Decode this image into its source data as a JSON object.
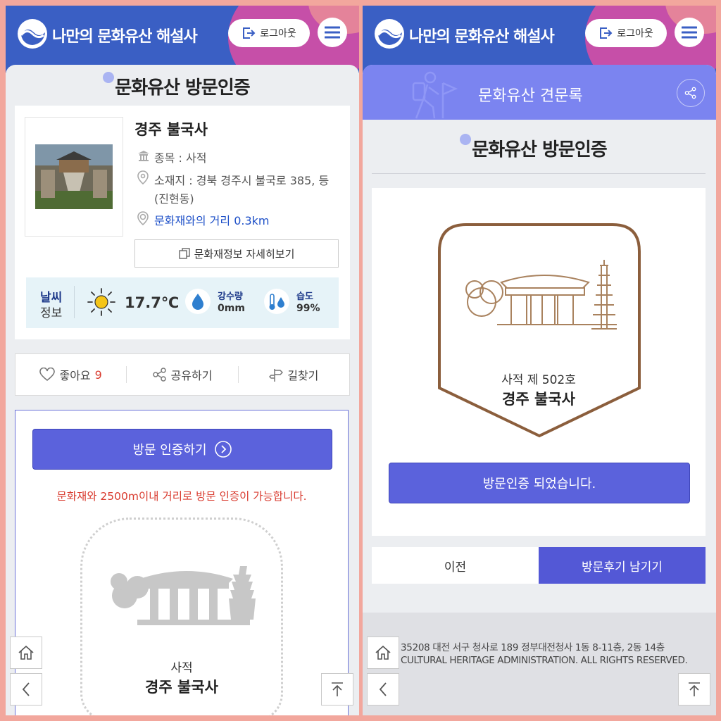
{
  "app": {
    "title": "나만의 문화유산 해설사",
    "logout_label": "로그아웃"
  },
  "left": {
    "page_title": "문화유산 방문인증",
    "heritage": {
      "name": "경주 불국사",
      "category_label": "종목 : 사적",
      "address_line1": "소재지 : 경북 경주시 불국로 385, 등",
      "address_line2": "(진현동)",
      "distance_label": "문화재와의 거리 0.3km",
      "detail_button": "문화재정보 자세히보기"
    },
    "weather": {
      "label_top": "날씨",
      "label_bottom": "정보",
      "temperature": "17.7℃",
      "rain_label": "강수량",
      "rain_value": "0mm",
      "humidity_label": "습도",
      "humidity_value": "99%"
    },
    "actions": {
      "like_label": "좋아요",
      "like_count": "9",
      "share_label": "공유하기",
      "route_label": "길찾기"
    },
    "certify_button": "방문 인증하기",
    "notice": "문화재와 2500m이내 거리로 방문 인증이 가능합니다.",
    "badge": {
      "type": "사적",
      "name": "경주 불국사"
    }
  },
  "right": {
    "section_title": "문화유산 견문록",
    "page_title": "문화유산 방문인증",
    "badge": {
      "type": "사적 제 502호",
      "name": "경주 불국사"
    },
    "done_button": "방문인증 되었습니다.",
    "prev_button": "이전",
    "review_button": "방문후기 남기기",
    "footer_address": "35208 대전 서구 청사로 189 정부대전청사 1동 8-11층, 2동 14층",
    "footer_copyright": "CULTURAL HERITAGE ADMINISTRATION. ALL RIGHTS RESERVED."
  },
  "colors": {
    "header": "#3a5fc4",
    "accent": "#5b62dc",
    "notice": "#d93b2f",
    "link": "#1e50c8",
    "section_band": "#7b84f0"
  }
}
